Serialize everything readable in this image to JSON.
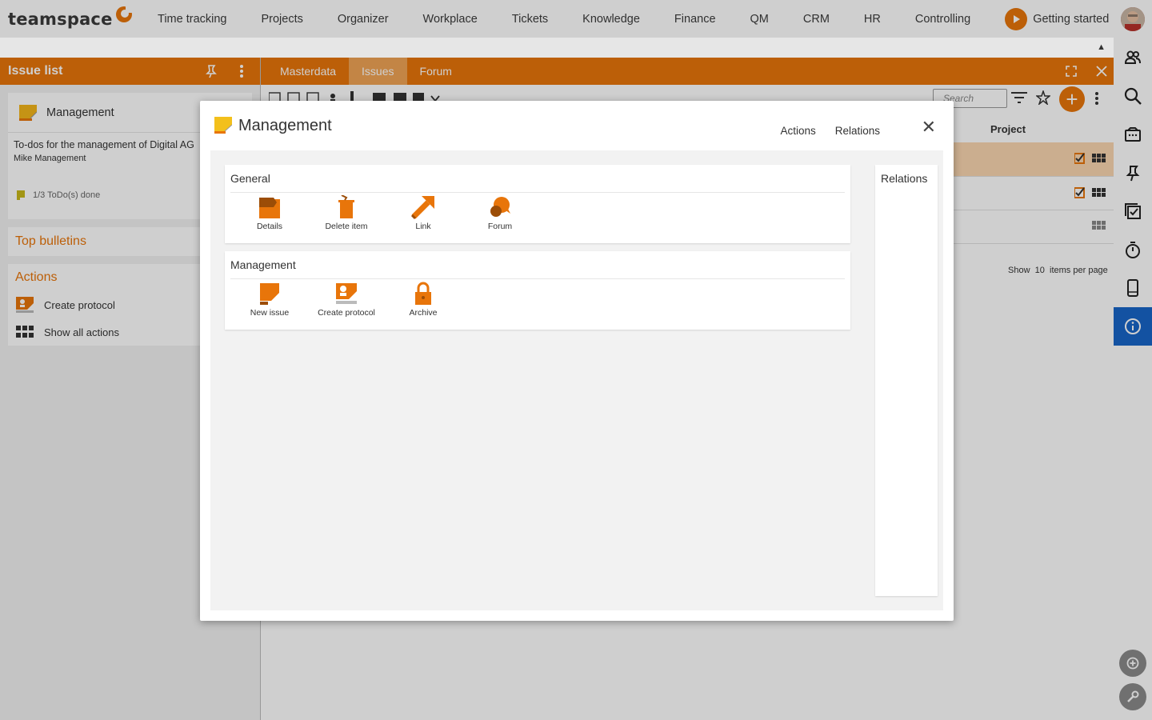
{
  "app": {
    "logo_text": "teamspace",
    "nav": [
      "Time tracking",
      "Projects",
      "Organizer",
      "Workplace",
      "Tickets",
      "Knowledge",
      "Finance",
      "QM",
      "CRM",
      "HR",
      "Controlling"
    ],
    "getting_started": "Getting started",
    "accent_color": "#e8750a",
    "info_color": "#1865c8"
  },
  "right_sidebar": {
    "icons": [
      "avatar",
      "people-icon",
      "search-icon",
      "inbox-icon",
      "pin-icon",
      "checklist-icon",
      "stopwatch-icon",
      "mobile-icon",
      "info-icon",
      "add-circle-icon",
      "wrench-icon"
    ]
  },
  "left_panel": {
    "title": "Issue list",
    "card": {
      "name": "Management",
      "description": "To-dos for the management of Digital AG",
      "owner": "Mike Management",
      "todo_status": "1/3 ToDo(s) done"
    },
    "top_bulletins": "Top bulletins",
    "actions_title": "Actions",
    "actions": [
      "Create protocol",
      "Show all actions"
    ]
  },
  "main_panel": {
    "tabs": [
      "Masterdata",
      "Issues",
      "Forum"
    ],
    "active_tab": "Issues",
    "search_placeholder": "Search",
    "column_project": "Project",
    "pager": {
      "show": "Show",
      "count": "10",
      "suffix": "items per page"
    }
  },
  "modal": {
    "title": "Management",
    "links": [
      "Actions",
      "Relations"
    ],
    "groups": [
      {
        "title": "General",
        "items": [
          "Details",
          "Delete item",
          "Link",
          "Forum"
        ]
      },
      {
        "title": "Management",
        "items": [
          "New issue",
          "Create protocol",
          "Archive"
        ]
      }
    ],
    "relations_title": "Relations"
  }
}
